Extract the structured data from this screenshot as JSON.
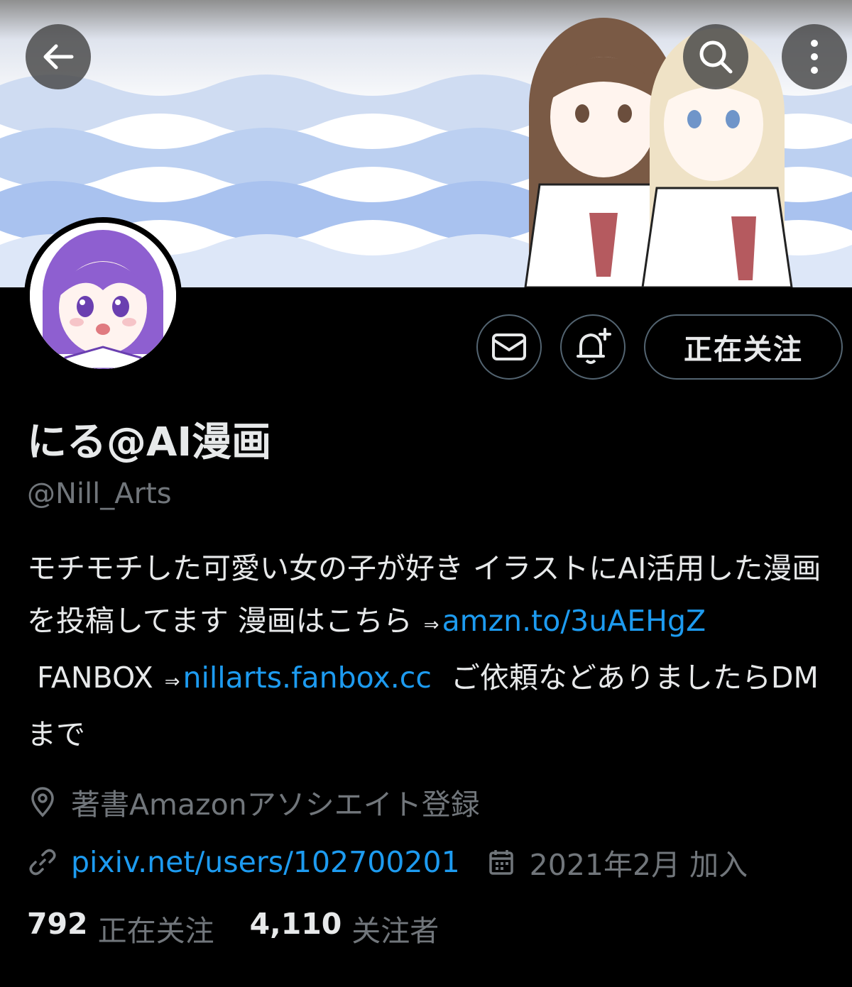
{
  "header": {
    "back_icon": "back-arrow-icon",
    "search_icon": "search-icon",
    "more_icon": "more-vertical-icon"
  },
  "actions": {
    "message_icon": "mail-icon",
    "notify_icon": "bell-plus-icon",
    "follow_label": "正在关注"
  },
  "profile": {
    "display_name": "にる@AI漫画",
    "handle": "@Nill_Arts",
    "bio": {
      "part1": "モチモチした可愛い女の子が好き イラストにAI活用した漫画を投稿してます 漫画はこちら",
      "arrow1": "⇒",
      "link1": "amzn.to/3uAEHgZ",
      "part2": "FANBOX",
      "arrow2": "⇒",
      "link2": "nillarts.fanbox.cc",
      "part3": "ご依頼などありましたらDMまで"
    },
    "location": "著書Amazonアソシエイト登録",
    "website": "pixiv.net/users/102700201",
    "joined": "2021年2月 加入"
  },
  "stats": {
    "following_count": "792",
    "following_label": "正在关注",
    "followers_count": "4,110",
    "followers_label": "关注者"
  },
  "colors": {
    "background": "#000000",
    "text": "#e7e9ea",
    "secondary": "#71767b",
    "link": "#1d9bf0",
    "border": "#536471"
  }
}
